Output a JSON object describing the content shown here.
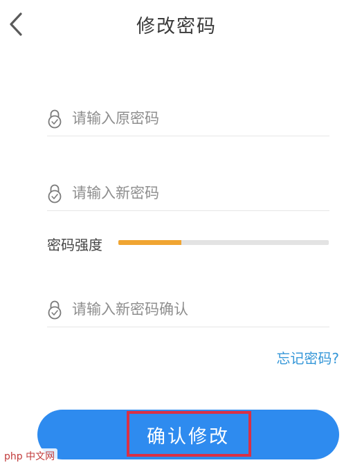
{
  "header": {
    "title": "修改密码",
    "back_icon": "chevron-left-icon"
  },
  "form": {
    "old_password": {
      "placeholder": "请输入原密码",
      "value": "",
      "icon": "lock-icon"
    },
    "new_password": {
      "placeholder": "请输入新密码",
      "value": "",
      "icon": "lock-icon"
    },
    "strength": {
      "label": "密码强度",
      "level_percent": 30,
      "fill_color": "#f0a532",
      "track_color": "#e3e3e3"
    },
    "confirm_password": {
      "placeholder": "请输入新密码确认",
      "value": "",
      "icon": "lock-icon"
    }
  },
  "links": {
    "forgot_password": "忘记密码?"
  },
  "actions": {
    "confirm_label": "确认修改",
    "confirm_color": "#2e8bef",
    "highlight_color": "#d93045"
  },
  "watermark": {
    "text": "php 中文网"
  }
}
